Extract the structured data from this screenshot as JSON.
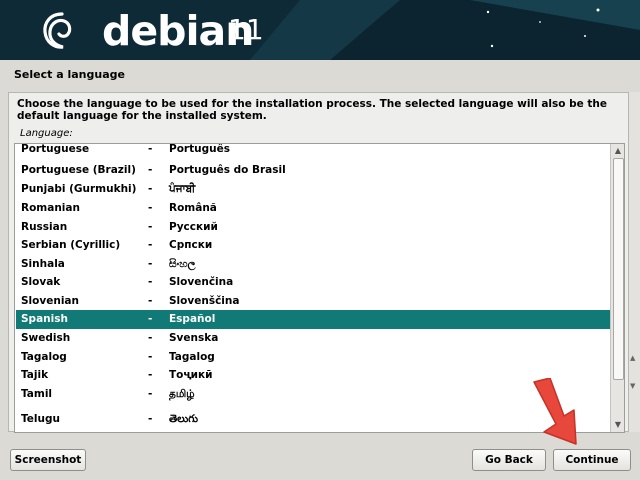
{
  "header": {
    "brand": "debian",
    "version": "11",
    "logo_icon": "debian-swirl-icon"
  },
  "step_title": "Select a language",
  "instruction": "Choose the language to be used for the installation process. The selected language will also be the default language for the installed system.",
  "list_label": "Language:",
  "languages": [
    {
      "name": "Portuguese",
      "sep": "-",
      "native": "Português"
    },
    {
      "name": "Portuguese (Brazil)",
      "sep": "-",
      "native": "Português do Brasil"
    },
    {
      "name": "Punjabi (Gurmukhi)",
      "sep": "-",
      "native": "ਪੰਜਾਬੀ"
    },
    {
      "name": "Romanian",
      "sep": "-",
      "native": "Română"
    },
    {
      "name": "Russian",
      "sep": "-",
      "native": "Русский"
    },
    {
      "name": "Serbian (Cyrillic)",
      "sep": "-",
      "native": "Српски"
    },
    {
      "name": "Sinhala",
      "sep": "-",
      "native": "සිංහල"
    },
    {
      "name": "Slovak",
      "sep": "-",
      "native": "Slovenčina"
    },
    {
      "name": "Slovenian",
      "sep": "-",
      "native": "Slovenščina"
    },
    {
      "name": "Spanish",
      "sep": "-",
      "native": "Español",
      "selected": true
    },
    {
      "name": "Swedish",
      "sep": "-",
      "native": "Svenska"
    },
    {
      "name": "Tagalog",
      "sep": "-",
      "native": "Tagalog"
    },
    {
      "name": "Tajik",
      "sep": "-",
      "native": "Тоҷикӣ"
    },
    {
      "name": "Tamil",
      "sep": "-",
      "native": "தமிழ்"
    },
    {
      "name": "Telugu",
      "sep": "-",
      "native": "తెలుగు"
    }
  ],
  "buttons": {
    "screenshot": "Screenshot",
    "go_back": "Go Back",
    "continue": "Continue"
  },
  "colors": {
    "banner": "#0e2a36",
    "selection": "#117a76",
    "annotation_arrow": "#e8473b"
  }
}
